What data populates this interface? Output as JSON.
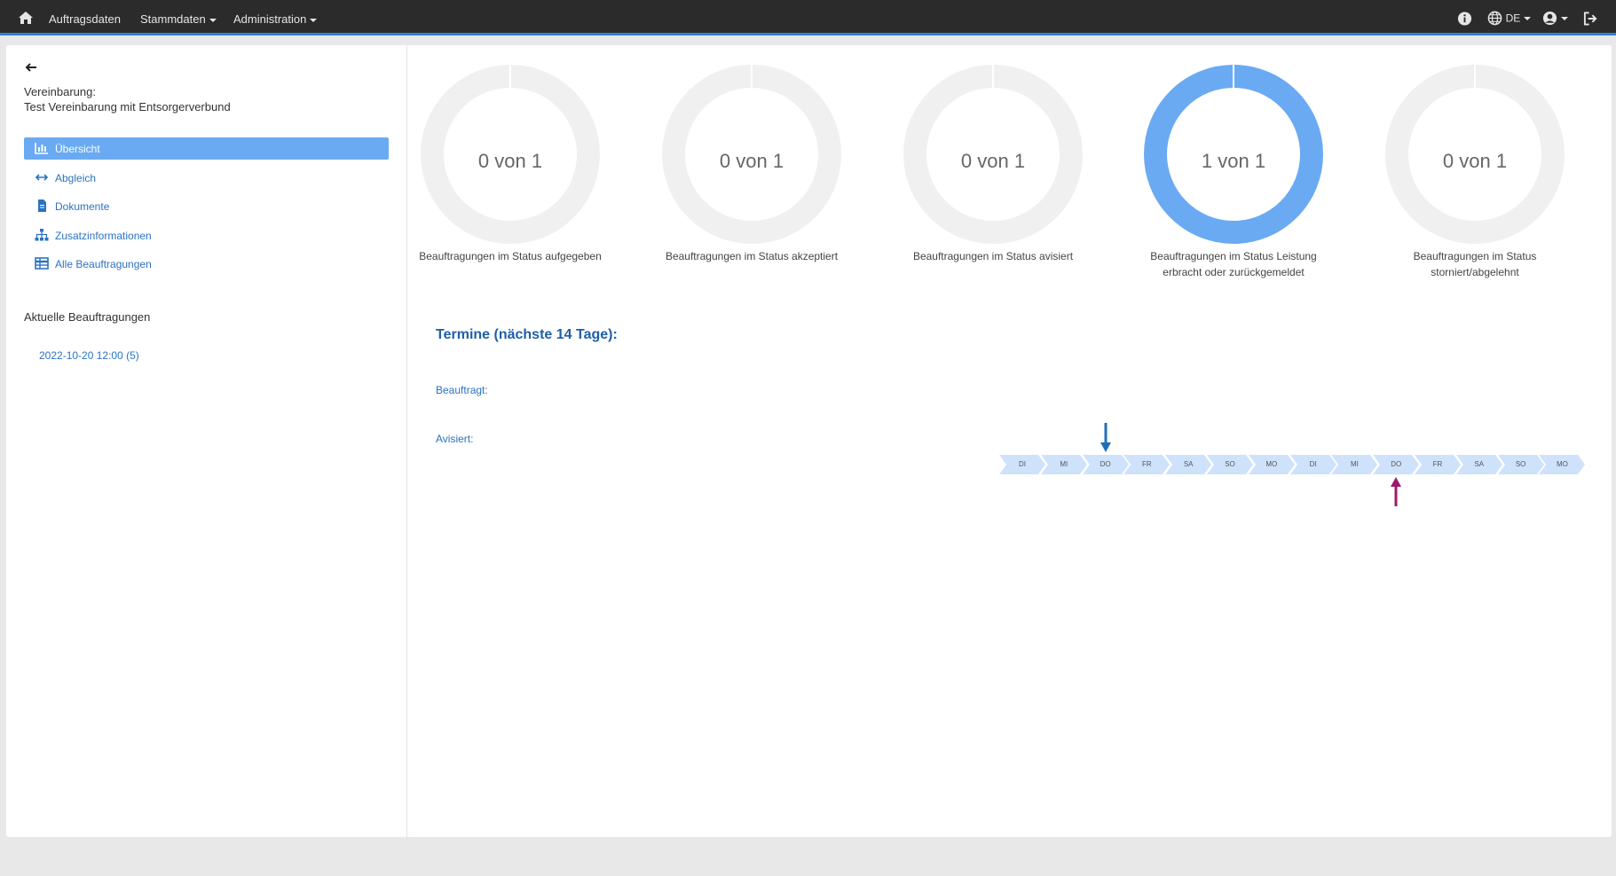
{
  "nav": {
    "home_icon": "home-icon",
    "items": [
      "Auftragsdaten",
      "Stammdaten",
      "Administration"
    ],
    "lang": "DE",
    "right_icons": [
      "info-icon",
      "globe-icon",
      "user-icon",
      "logout-icon"
    ]
  },
  "sidebar": {
    "agreement_label": "Vereinbarung:",
    "agreement_name": "Test Vereinbarung mit Entsorgerverbund",
    "menu": [
      {
        "label": "Übersicht",
        "icon": "chart-icon",
        "active": true
      },
      {
        "label": "Abgleich",
        "icon": "arrows-horizontal-icon",
        "active": false
      },
      {
        "label": "Dokumente",
        "icon": "document-icon",
        "active": false
      },
      {
        "label": "Zusatzinformationen",
        "icon": "sitemap-icon",
        "active": false
      },
      {
        "label": "Alle Beauftragungen",
        "icon": "table-icon",
        "active": false
      }
    ],
    "current_title": "Aktuelle Beauftragungen",
    "current_link": "2022-10-20 12:00 (5)"
  },
  "stats": [
    {
      "text": "0 von 1",
      "caption": [
        "Beauftragungen im Status aufgegeben"
      ],
      "value": 0
    },
    {
      "text": "0 von 1",
      "caption": [
        "Beauftragungen im Status akzeptiert"
      ],
      "value": 0
    },
    {
      "text": "0 von 1",
      "caption": [
        "Beauftragungen im Status avisiert"
      ],
      "value": 0
    },
    {
      "text": "1 von 1",
      "caption": [
        "Beauftragungen im Status Leistung",
        "erbracht oder zurückgemeldet"
      ],
      "value": 1
    },
    {
      "text": "0 von 1",
      "caption": [
        "Beauftragungen im Status",
        "storniert/abgelehnt"
      ],
      "value": 0
    }
  ],
  "termine": {
    "title": "Termine (nächste 14 Tage):",
    "label_beauftragt": "Beauftragt:",
    "label_avisiert": "Avisiert:",
    "days": [
      "DI",
      "MI",
      "DO",
      "FR",
      "SA",
      "SO",
      "MO",
      "DI",
      "MI",
      "DO",
      "FR",
      "SA",
      "SO",
      "MO"
    ],
    "beauftragt_day_index": 2,
    "avisiert_day_index": 9,
    "colors": {
      "chevron": "#cfe2fb",
      "beauftragt": "#1f6fb8",
      "avisiert": "#9c1a6e",
      "donut_fill": "#6aaaf2",
      "donut_empty": "#f0f0f0"
    }
  }
}
